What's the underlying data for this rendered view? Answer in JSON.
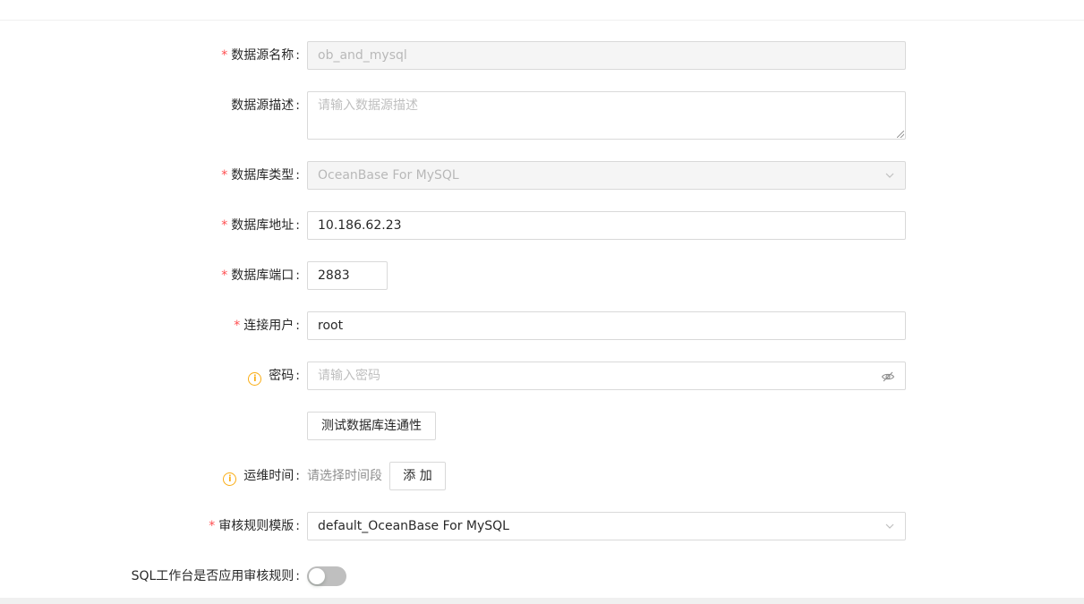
{
  "form": {
    "datasource_name": {
      "label": "数据源名称",
      "value": "ob_and_mysql",
      "required": true
    },
    "datasource_desc": {
      "label": "数据源描述",
      "placeholder": "请输入数据源描述"
    },
    "db_type": {
      "label": "数据库类型",
      "value": "OceanBase For MySQL",
      "required": true
    },
    "db_host": {
      "label": "数据库地址",
      "value": "10.186.62.23",
      "required": true
    },
    "db_port": {
      "label": "数据库端口",
      "value": "2883",
      "required": true
    },
    "db_user": {
      "label": "连接用户",
      "value": "root",
      "required": true
    },
    "db_password": {
      "label": "密码",
      "placeholder": "请输入密码",
      "info_icon": "info-circle-icon"
    },
    "test_connection_button": "测试数据库连通性",
    "maintenance_time": {
      "label": "运维时间",
      "hint": "请选择时间段",
      "add_button": "添 加",
      "info_icon": "info-circle-icon"
    },
    "audit_rule_template": {
      "label": "审核规则模版",
      "value": "default_OceanBase For MySQL",
      "required": true
    },
    "sql_workbench_audit": {
      "label": "SQL工作台是否应用审核规则",
      "enabled": false
    }
  },
  "colon": ":",
  "required_mark": "*",
  "info_glyph": "i",
  "colors": {
    "required": "#ff4d4f",
    "info": "#faad14",
    "border": "#d9d9d9",
    "disabled_bg": "#f5f5f5",
    "switch_off": "#bfbfbf"
  }
}
